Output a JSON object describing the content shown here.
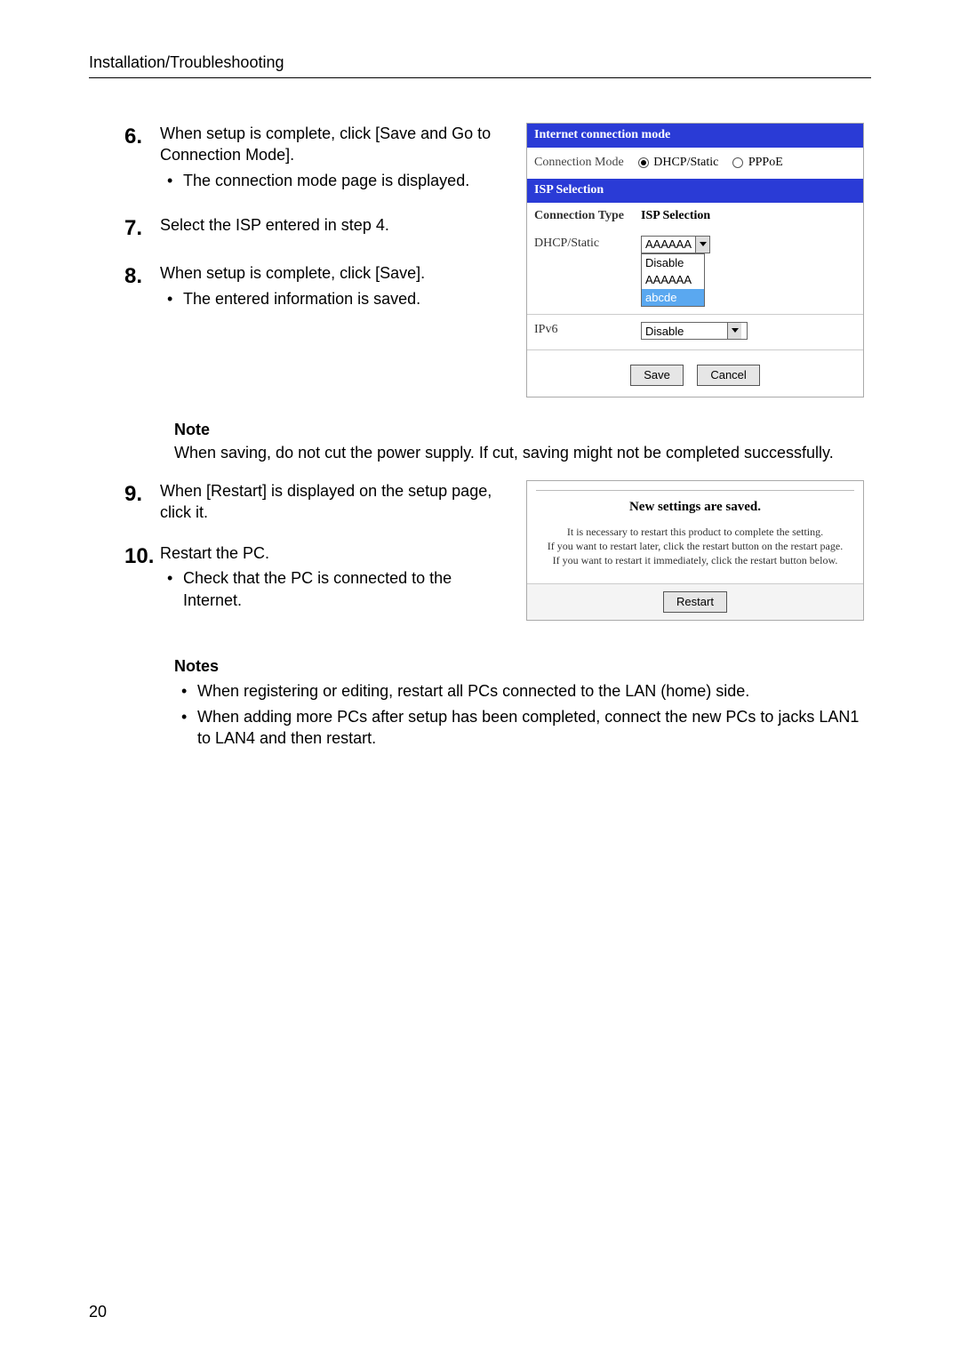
{
  "header": "Installation/Troubleshooting",
  "page_number": "20",
  "steps": {
    "s6": {
      "num": "6.",
      "text": "When setup is complete, click [Save and Go to Connection Mode].",
      "bullet": "The connection mode page is displayed."
    },
    "s7": {
      "num": "7.",
      "text": "Select the ISP entered in step 4."
    },
    "s8": {
      "num": "8.",
      "text": "When setup is complete, click [Save].",
      "bullet": "The entered information is saved."
    },
    "s9": {
      "num": "9.",
      "text": "When [Restart] is displayed on the setup page, click it."
    },
    "s10": {
      "num": "10.",
      "text": "Restart the PC.",
      "bullet": "Check that the PC is connected to the Internet."
    }
  },
  "note1": {
    "title": "Note",
    "text": "When saving, do not cut the power supply. If cut, saving might not be completed successfully."
  },
  "notes2": {
    "title": "Notes",
    "b1": "When registering or editing, restart all PCs connected to the LAN (home) side.",
    "b2": "When adding more PCs after setup has been completed, connect the new PCs to jacks LAN1 to LAN4 and then restart."
  },
  "panel1": {
    "bar1": "Internet connection mode",
    "conn_label": "Connection Mode",
    "radio1": "DHCP/Static",
    "radio2": "PPPoE",
    "bar2": "ISP Selection",
    "col1": "Connection Type",
    "col2": "ISP Selection",
    "row1_label": "DHCP/Static",
    "row2_label": "IPv6",
    "combo_aa": "AAAAAA",
    "opt_disable": "Disable",
    "opt_aa2": "AAAAAA",
    "opt_abcde": "abcde",
    "combo_disable": "Disable",
    "btn_save": "Save",
    "btn_cancel": "Cancel"
  },
  "panel2": {
    "title": "New settings are saved.",
    "line1": "It is necessary to restart this product to complete the setting.",
    "line2": "If you want to restart later, click the restart button on the restart page.",
    "line3": "If you want to restart it immediately, click the restart button below.",
    "btn": "Restart"
  }
}
